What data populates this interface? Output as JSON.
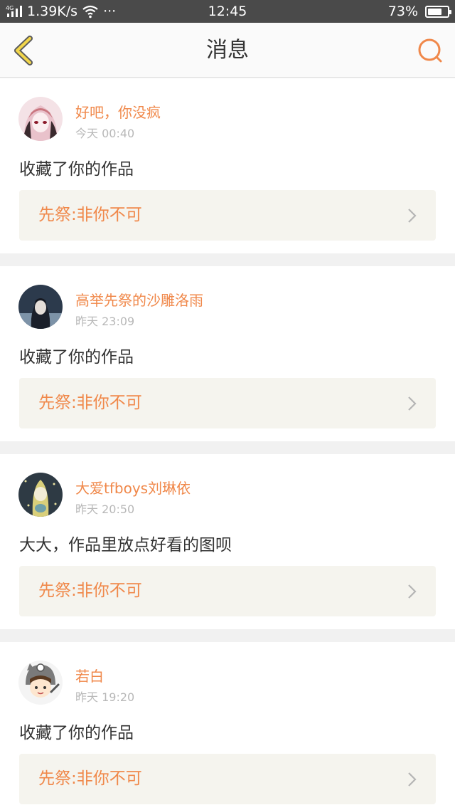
{
  "status_bar": {
    "network": "4G",
    "speed": "1.39K/s",
    "more": "···",
    "time": "12:45",
    "battery": "73%",
    "battery_level": 0.73
  },
  "header": {
    "title": "消息",
    "back_icon": "chevron-left-icon",
    "search_icon": "search-icon",
    "accent_color": "#f0884a"
  },
  "messages": [
    {
      "username": "好吧，你没疯",
      "time": "今天 00:40",
      "content": "收藏了你的作品",
      "work_title": "先祭:非你不可"
    },
    {
      "username": "高举先祭的沙雕洛雨",
      "time": "昨天 23:09",
      "content": "收藏了你的作品",
      "work_title": "先祭:非你不可"
    },
    {
      "username": "大爱tfboys刘琳依",
      "time": "昨天 20:50",
      "content": "大大，作品里放点好看的图呗",
      "work_title": "先祭:非你不可"
    },
    {
      "username": "若白",
      "time": "昨天 19:20",
      "content": "收藏了你的作品",
      "work_title": "先祭:非你不可"
    }
  ]
}
